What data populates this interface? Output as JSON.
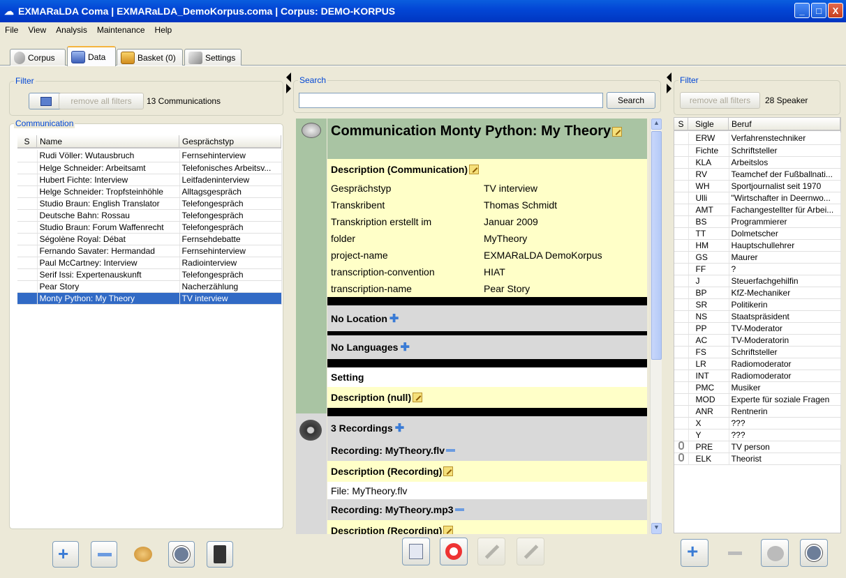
{
  "window": {
    "title": "EXMARaLDA Coma | EXMARaLDA_DemoKorpus.coma | Corpus: DEMO-KORPUS",
    "btn_min": "_",
    "btn_max": "□",
    "btn_close": "X"
  },
  "menu": [
    "File",
    "View",
    "Analysis",
    "Maintenance",
    "Help"
  ],
  "tabs": [
    {
      "label": "Corpus"
    },
    {
      "label": "Data"
    },
    {
      "label": "Basket (0)"
    },
    {
      "label": "Settings"
    }
  ],
  "left": {
    "filter_title": "Filter",
    "remove_filters": "remove all filters",
    "count": "13 Communications",
    "comm_title": "Communication",
    "cols": [
      "S",
      "Name",
      "Gesprächstyp"
    ],
    "rows": [
      [
        "Rudi Völler: Wutausbruch",
        "Fernsehinterview"
      ],
      [
        "Helge Schneider: Arbeitsamt",
        "Telefonisches Arbeitsv..."
      ],
      [
        "Hubert Fichte: Interview",
        "Leitfadeninterview"
      ],
      [
        "Helge Schneider: Tropfsteinhöhle",
        "Alltagsgespräch"
      ],
      [
        "Studio Braun: English Translator",
        "Telefongespräch"
      ],
      [
        "Deutsche Bahn: Rossau",
        "Telefongespräch"
      ],
      [
        "Studio Braun: Forum Waffenrecht",
        "Telefongespräch"
      ],
      [
        "Ségolène Royal: Débat",
        "Fernsehdebatte"
      ],
      [
        "Fernando Savater: Hermandad",
        "Fernsehinterview"
      ],
      [
        "Paul McCartney: Interview",
        "Radiointerview"
      ],
      [
        "Serif Issi: Expertenauskunft",
        "Telefongespräch"
      ],
      [
        "Pear Story",
        "Nacherzählung"
      ],
      [
        "Monty Python: My Theory",
        "TV interview"
      ]
    ]
  },
  "center": {
    "search_title": "Search",
    "search_placeholder": "",
    "search_btn": "Search",
    "heading": "Communication Monty Python: My Theory",
    "desc_comm": "Description (Communication)",
    "kv": [
      [
        "Gesprächstyp",
        "TV interview"
      ],
      [
        "Transkribent",
        "Thomas Schmidt"
      ],
      [
        "Transkription erstellt im",
        "Januar 2009"
      ],
      [
        "folder",
        "MyTheory"
      ],
      [
        "project-name",
        "EXMARaLDA DemoKorpus"
      ],
      [
        "transcription-convention",
        "HIAT"
      ],
      [
        "transcription-name",
        "Pear Story"
      ]
    ],
    "no_location": "No Location",
    "no_languages": "No Languages",
    "setting": "Setting",
    "desc_null": "Description (null)",
    "recordings": "3 Recordings",
    "rec1": "Recording: MyTheory.flv",
    "desc_rec": "Description (Recording)",
    "file1": "File: MyTheory.flv",
    "rec2": "Recording: MyTheory.mp3"
  },
  "right": {
    "filter_title": "Filter",
    "remove_filters": "remove all filters",
    "count": "28 Speaker",
    "cols": [
      "S",
      "Sigle",
      "Beruf"
    ],
    "rows": [
      [
        "",
        "ERW",
        "Verfahrenstechniker"
      ],
      [
        "",
        "Fichte",
        "Schriftsteller"
      ],
      [
        "",
        "KLA",
        "Arbeitslos"
      ],
      [
        "",
        "RV",
        "Teamchef der Fußballnati..."
      ],
      [
        "",
        "WH",
        "Sportjournalist seit 1970"
      ],
      [
        "",
        "Ulli",
        "\"Wirtschafter in Deernwo..."
      ],
      [
        "",
        "AMT",
        "Fachangestellter für Arbei..."
      ],
      [
        "",
        "BS",
        "Programmierer"
      ],
      [
        "",
        "TT",
        "Dolmetscher"
      ],
      [
        "",
        "HM",
        "Hauptschullehrer"
      ],
      [
        "",
        "GS",
        "Maurer"
      ],
      [
        "",
        "FF",
        "?"
      ],
      [
        "",
        "J",
        "Steuerfachgehilfin"
      ],
      [
        "",
        "BP",
        "KfZ-Mechaniker"
      ],
      [
        "",
        "SR",
        "Politikerin"
      ],
      [
        "",
        "NS",
        "Staatspräsident"
      ],
      [
        "",
        "PP",
        "TV-Moderator"
      ],
      [
        "",
        "AC",
        "TV-Moderatorin"
      ],
      [
        "",
        "FS",
        "Schriftsteller"
      ],
      [
        "",
        "LR",
        "Radiomoderator"
      ],
      [
        "",
        "INT",
        "Radiomoderator"
      ],
      [
        "",
        "PMC",
        "Musiker"
      ],
      [
        "",
        "MOD",
        "Experte für soziale Fragen"
      ],
      [
        "",
        "ANR",
        "Rentnerin"
      ],
      [
        "",
        "X",
        "???"
      ],
      [
        "",
        "Y",
        "???"
      ],
      [
        "clip",
        "PRE",
        "TV person"
      ],
      [
        "clip",
        "ELK",
        "Theorist"
      ]
    ]
  }
}
